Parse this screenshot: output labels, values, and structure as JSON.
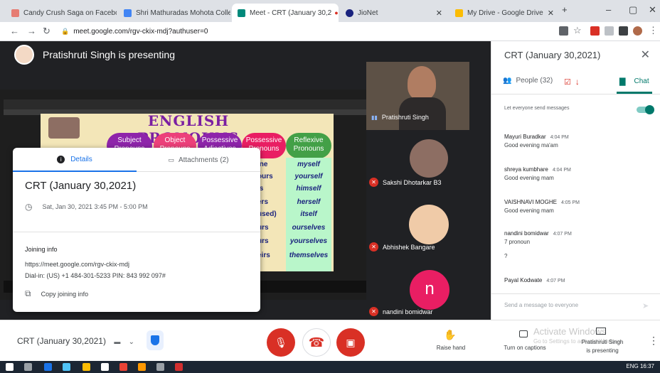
{
  "browser": {
    "tabs": [
      {
        "title": "Candy Crush Saga on Faceboo",
        "color": "#e67c73"
      },
      {
        "title": "Shri Mathuradas Mohota Colle",
        "color": "#4285f4"
      },
      {
        "title": "Meet - CRT (January 30,2",
        "color": "#00897b"
      },
      {
        "title": "JioNet",
        "color": "#1a237e"
      },
      {
        "title": "My Drive - Google Drive",
        "color": "#fbbc04"
      }
    ],
    "url": "meet.google.com/rgv-ckix-mdj?authuser=0"
  },
  "presenter": {
    "label": "Pratishruti Singh is presenting"
  },
  "slide": {
    "title": "ENGLISH PRONOUNS",
    "headers": [
      "Subject Pronouns",
      "Object Pronouns",
      "Possessive Adjectives",
      "Possessive Pronouns",
      "Reflexive Pronouns"
    ],
    "mid_col": [
      "ine",
      "ours",
      "is",
      "ers",
      "used)",
      "urs",
      "urs",
      "eirs"
    ],
    "reflexive": [
      "myself",
      "yourself",
      "himself",
      "herself",
      "itself",
      "ourselves",
      "yourselves",
      "themselves"
    ]
  },
  "details": {
    "tab_details": "Details",
    "tab_attachments": "Attachments (2)",
    "title": "CRT (January 30,2021)",
    "time": "Sat, Jan 30, 2021 3:45 PM - 5:00 PM",
    "joining_label": "Joining info",
    "link": "https://meet.google.com/rgv-ckix-mdj",
    "dial": "Dial-in: (US) +1 484-301-5233  PIN: 843 992 097#",
    "copy": "Copy joining info"
  },
  "tiles": [
    {
      "name": "Pratishruti Singh"
    },
    {
      "name": "Sakshi Dhotarkar B3"
    },
    {
      "name": "Abhishek Bangare"
    },
    {
      "name": "nandini bomidwar",
      "initial": "n"
    }
  ],
  "panel": {
    "title": "CRT (January 30,2021)",
    "people": "People (32)",
    "chat": "Chat",
    "let_everyone": "Let everyone send messages",
    "messages": [
      {
        "name": "Mayuri Buradkar",
        "time": "4:04 PM",
        "text": "Good evening ma'am"
      },
      {
        "name": "shreya kumbhare",
        "time": "4:04 PM",
        "text": "Good evening mam"
      },
      {
        "name": "VAISHNAVI MOGHE",
        "time": "4:05 PM",
        "text": "Good evening mam"
      },
      {
        "name": "nandini bomidwar",
        "time": "4:07 PM",
        "text": "7 pronoun",
        "text2": "?"
      },
      {
        "name": "Payal Kodwate",
        "time": "4:07 PM",
        "text": ""
      }
    ],
    "send_placeholder": "Send a message to everyone"
  },
  "bottom": {
    "meeting": "CRT (January 30,2021)",
    "raise_hand": "Raise hand",
    "captions": "Turn on captions",
    "presenting_line1": "Pratishruti Singh",
    "presenting_line2": "is presenting",
    "activate": "Activate Windows",
    "activate_sub": "Go to Settings to activate Windows."
  },
  "taskbar": {
    "tray": "ENG  16:37"
  }
}
